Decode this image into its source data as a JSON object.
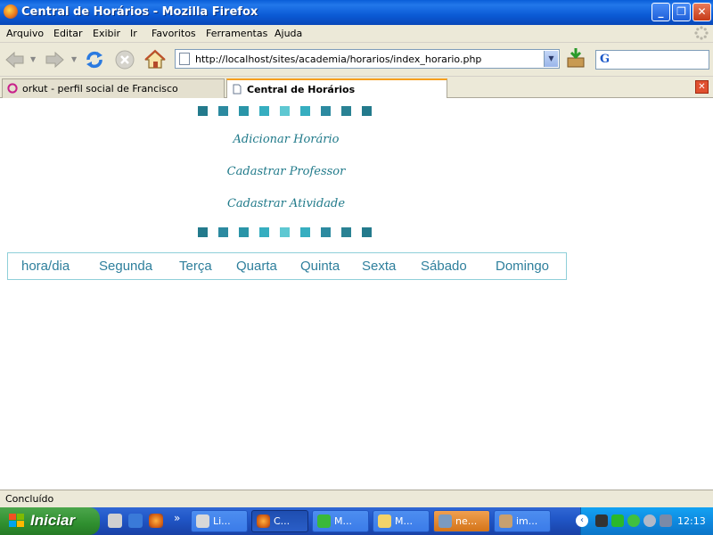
{
  "window": {
    "title": "Central de Horários - Mozilla Firefox",
    "minimize_glyph": "_",
    "maximize_glyph": "❐",
    "close_glyph": "✕"
  },
  "menubar": {
    "items": [
      "Arquivo",
      "Editar",
      "Exibir",
      "Ir",
      "Favoritos",
      "Ferramentas",
      "Ajuda"
    ]
  },
  "navbar": {
    "url": "http://localhost/sites/academia/horarios/index_horario.php",
    "search_logo": "G"
  },
  "tabs": [
    {
      "label": "orkut - perfil social de Francisco",
      "icon": "orkut-icon",
      "active": false
    },
    {
      "label": "Central de Horários",
      "icon": "page-icon",
      "active": true
    }
  ],
  "page": {
    "square_colors": [
      "#237a8c",
      "#2c8aa0",
      "#2a95a8",
      "#36aec0",
      "#5ec8d2",
      "#36aec0",
      "#2c8aa0",
      "#2a8294",
      "#237a8c"
    ],
    "links": [
      "Adicionar Horário",
      "Cadastrar Professor",
      "Cadastrar Atividade"
    ],
    "schedule_header": [
      "hora/dia",
      "Segunda",
      "Terça",
      "Quarta",
      "Quinta",
      "Sexta",
      "Sábado",
      "Domingo"
    ],
    "accent_color": "#2e7f9c"
  },
  "status": {
    "text": "Concluído"
  },
  "taskbar": {
    "start_label": "Iniciar",
    "overflow_glyph": "»",
    "tasks": [
      {
        "label": "Li...",
        "icon": "skull-app-icon",
        "style": "normal"
      },
      {
        "label": "C...",
        "icon": "firefox-icon",
        "style": "active"
      },
      {
        "label": "M...",
        "icon": "messenger-icon",
        "style": "normal"
      },
      {
        "label": "M...",
        "icon": "folder-icon",
        "style": "normal"
      },
      {
        "label": "ne...",
        "icon": "network-app-icon",
        "style": "orange"
      },
      {
        "label": "im...",
        "icon": "image-app-icon",
        "style": "normal"
      }
    ],
    "clock": "12:13"
  }
}
